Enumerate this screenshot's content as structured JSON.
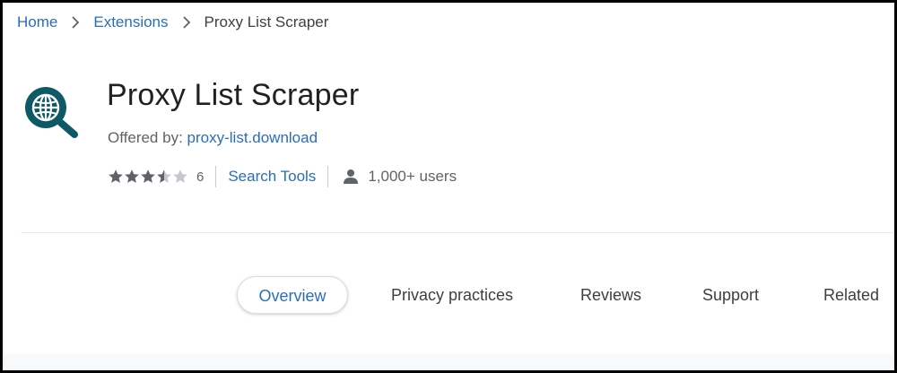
{
  "breadcrumb": {
    "home": "Home",
    "extensions": "Extensions",
    "current": "Proxy List Scraper"
  },
  "extension": {
    "title": "Proxy List Scraper",
    "offered_by_label": "Offered by:",
    "offered_by_link": "proxy-list.download",
    "rating": 3.5,
    "rating_count": "6",
    "category": "Search Tools",
    "users": "1,000+ users",
    "icon": "globe-magnifier-icon"
  },
  "tabs": [
    {
      "label": "Overview",
      "active": true
    },
    {
      "label": "Privacy practices",
      "active": false
    },
    {
      "label": "Reviews",
      "active": false
    },
    {
      "label": "Support",
      "active": false
    },
    {
      "label": "Related",
      "active": false
    }
  ],
  "colors": {
    "link": "#2a6ebb",
    "icon_teal": "#0d5a66",
    "star_filled": "#5f6368",
    "star_empty": "#c4c7cc",
    "text_primary": "#202124",
    "text_secondary": "#5f6368"
  }
}
